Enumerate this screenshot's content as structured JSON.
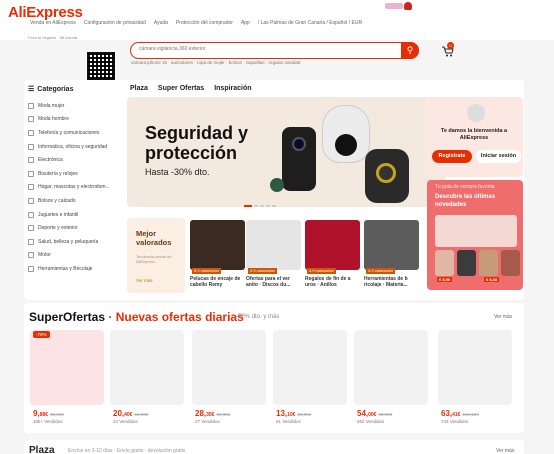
{
  "topbar": {
    "links": [
      "Venda en AliExpress",
      "Configuración de privacidad",
      "Ayuda",
      "Protección del comprador",
      "App",
      "/ Las Palmas de Gran Canaria / Español / EUR"
    ]
  },
  "header": {
    "logo": "AliExpress",
    "logo_small": [
      "Crea tu negocio",
      "Mi cuenta"
    ],
    "qr_label": "Descargar la app",
    "search_placeholder": "cámara vigilancia 360 exterior",
    "search_suggestions": "camara iphone 15 · auriculares · ropa de mujer · bolsos · zapatillas · regalos navidad",
    "cart_count": "0"
  },
  "categories": {
    "title": "Categorías",
    "items": [
      "Moda mujer",
      "Moda hombre",
      "Telefonía y comunicaciones",
      "Informática, oficina y seguridad",
      "Electrónica",
      "Bisutería y relojes",
      "Hogar, mascotas y electrodom...",
      "Bolsos y calzado",
      "Juguetes e infantil",
      "Deporte y exterior",
      "Salud, belleza y peluquería",
      "Motor",
      "Herramientas y Bricolaje"
    ]
  },
  "nav": {
    "tabs": [
      "Plaza",
      "Super Ofertas",
      "Inspiración"
    ]
  },
  "banner": {
    "title": "Seguridad y protección",
    "subtitle": "Hasta -30% dto."
  },
  "welcome": {
    "text": "Te damos la bienvenida a AliExpress",
    "register": "Regístrate",
    "login": "Iniciar sesión"
  },
  "promo": {
    "title": "Tu guía de compra favorita",
    "text": "Descubre las últimas novedades",
    "prices": [
      "€ 8,90",
      "€ 8,38"
    ]
  },
  "mejor": {
    "title": "Mejor valorados",
    "subtitle": "Tendencia actual de AliExpress",
    "link": "Ver más"
  },
  "tiles": [
    {
      "badge": "5.0 valoración",
      "caption": "Pelucas de encaje de cabello Remy"
    },
    {
      "badge": "4.9 valoración",
      "caption": "Ofertas para el ver anito · Discos du..."
    },
    {
      "badge": "4.9 valoración",
      "caption": "Regalos de fin de a uros · Anillos"
    },
    {
      "badge": "4.9 valoración",
      "caption": "Herramientas de b ricolaje · Materia..."
    }
  ],
  "super": {
    "title_a": "SuperOfertas",
    "title_b": " · Nuevas ofertas diarias",
    "subtitle": "-50% dto. y más",
    "ver_mas": "Ver más",
    "badge": "-70%",
    "products": [
      {
        "price_int": "9,",
        "price_dec": "88€",
        "old": "30,00€",
        "sold": "10k+ Vendidos"
      },
      {
        "price_int": "20,",
        "price_dec": "40€",
        "old": "54,00€",
        "sold": "24 Vendidos"
      },
      {
        "price_int": "28,",
        "price_dec": "35€",
        "old": "86,00€",
        "sold": "27 Vendidos"
      },
      {
        "price_int": "13,",
        "price_dec": "10€",
        "old": "25,99€",
        "sold": "61 Vendidos"
      },
      {
        "price_int": "54,",
        "price_dec": "00€",
        "old": "99,00€",
        "sold": "262 Vendidos"
      },
      {
        "price_int": "63,",
        "price_dec": "41€",
        "old": "156,10€",
        "sold": "743 Vendidos"
      }
    ]
  },
  "plaza": {
    "title": "Plaza",
    "subtitle": "Envíos en 3-10 días · Envío gratis · devolución gratis",
    "ver_mas": "Ver más"
  },
  "colors": {
    "accent": "#e62e04",
    "banner_bg": "#f4e9de",
    "promo_bg": "#f06d6d"
  }
}
